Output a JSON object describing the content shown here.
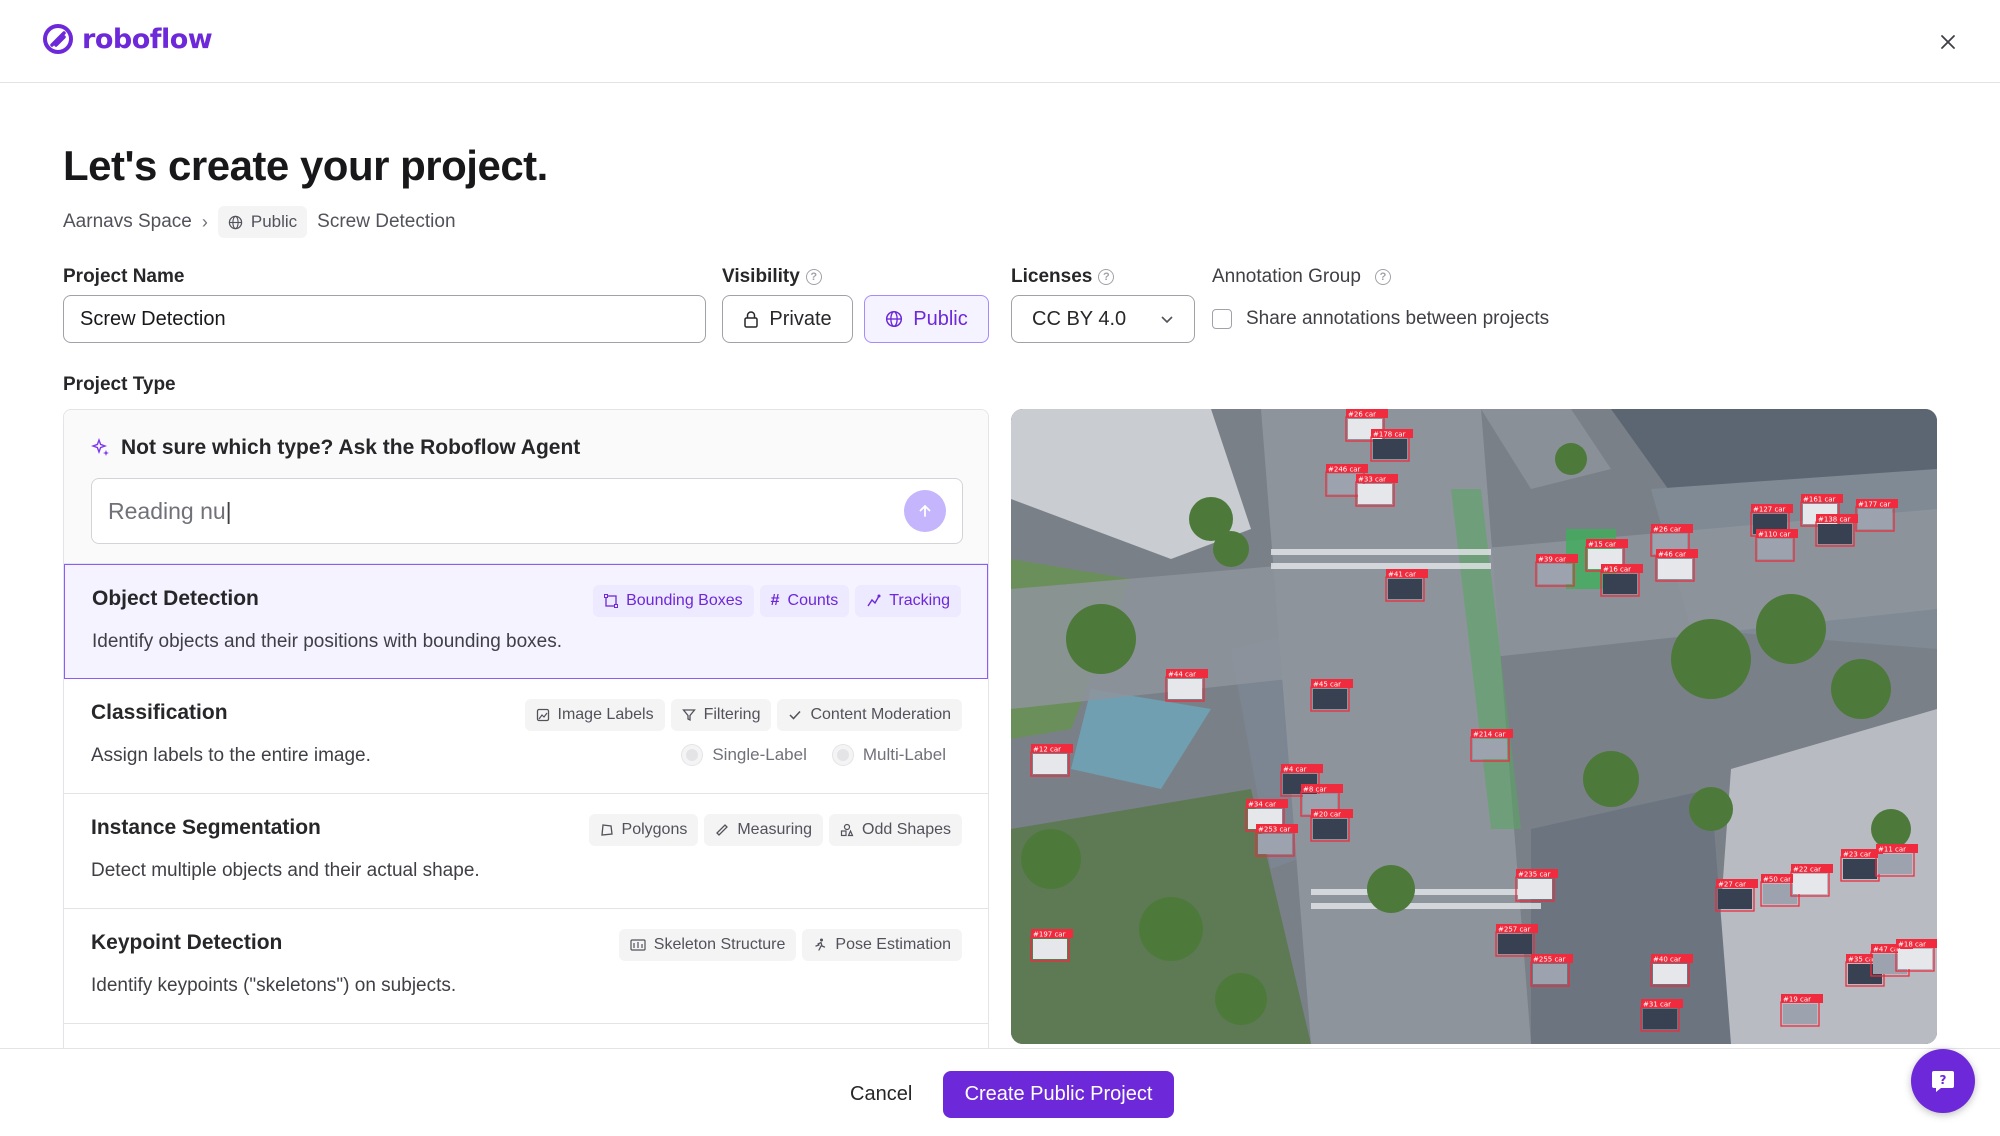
{
  "brand": {
    "name": "roboflow",
    "color": "#6d28d9"
  },
  "title": "Let's create your project.",
  "breadcrumb": {
    "workspace": "Aarnavs Space",
    "visibility": "Public",
    "project": "Screw Detection"
  },
  "form": {
    "project_name_label": "Project Name",
    "project_name_value": "Screw Detection",
    "visibility_label": "Visibility",
    "private_label": "Private",
    "public_label": "Public",
    "selected_visibility": "Public",
    "licenses_label": "Licenses",
    "license_value": "CC BY 4.0",
    "annotation_group_label": "Annotation Group",
    "share_label": "Share annotations between projects",
    "share_checked": false,
    "project_type_label": "Project Type"
  },
  "agent": {
    "title": "Not sure which type? Ask the Roboflow Agent",
    "input_text": "Reading nu"
  },
  "project_types": [
    {
      "name": "Object Detection",
      "description": "Identify objects and their positions with bounding boxes.",
      "tags": [
        "Bounding Boxes",
        "Counts",
        "Tracking"
      ],
      "selected": true
    },
    {
      "name": "Classification",
      "description": "Assign labels to the entire image.",
      "tags": [
        "Image Labels",
        "Filtering",
        "Content Moderation"
      ],
      "options": [
        "Single-Label",
        "Multi-Label"
      ]
    },
    {
      "name": "Instance Segmentation",
      "description": "Detect multiple objects and their actual shape.",
      "tags": [
        "Polygons",
        "Measuring",
        "Odd Shapes"
      ]
    },
    {
      "name": "Keypoint Detection",
      "description": "Identify keypoints (\"skeletons\") on subjects.",
      "tags": [
        "Skeleton Structure",
        "Pose Estimation"
      ]
    }
  ],
  "preview": {
    "detections": [
      "#26 car",
      "#178 car",
      "#246 car",
      "#33 car",
      "#41 car",
      "#39 car",
      "#15 car",
      "#16 car",
      "#26 car",
      "#46 car",
      "#127 car",
      "#110 car",
      "#161 car",
      "#138 car",
      "#177 car",
      "#44 car",
      "#45 car",
      "#214 car",
      "#12 car",
      "#4 car",
      "#8 car",
      "#34 car",
      "#20 car",
      "#253 car",
      "#235 car",
      "#27 car",
      "#50 car",
      "#22 car",
      "#23 car",
      "#11 car",
      "#197 car",
      "#257 car",
      "#255 car",
      "#40 car",
      "#35 car",
      "#47 car",
      "#18 car",
      "#31 car",
      "#19 car"
    ]
  },
  "footer": {
    "cancel_label": "Cancel",
    "create_label": "Create Public Project"
  }
}
